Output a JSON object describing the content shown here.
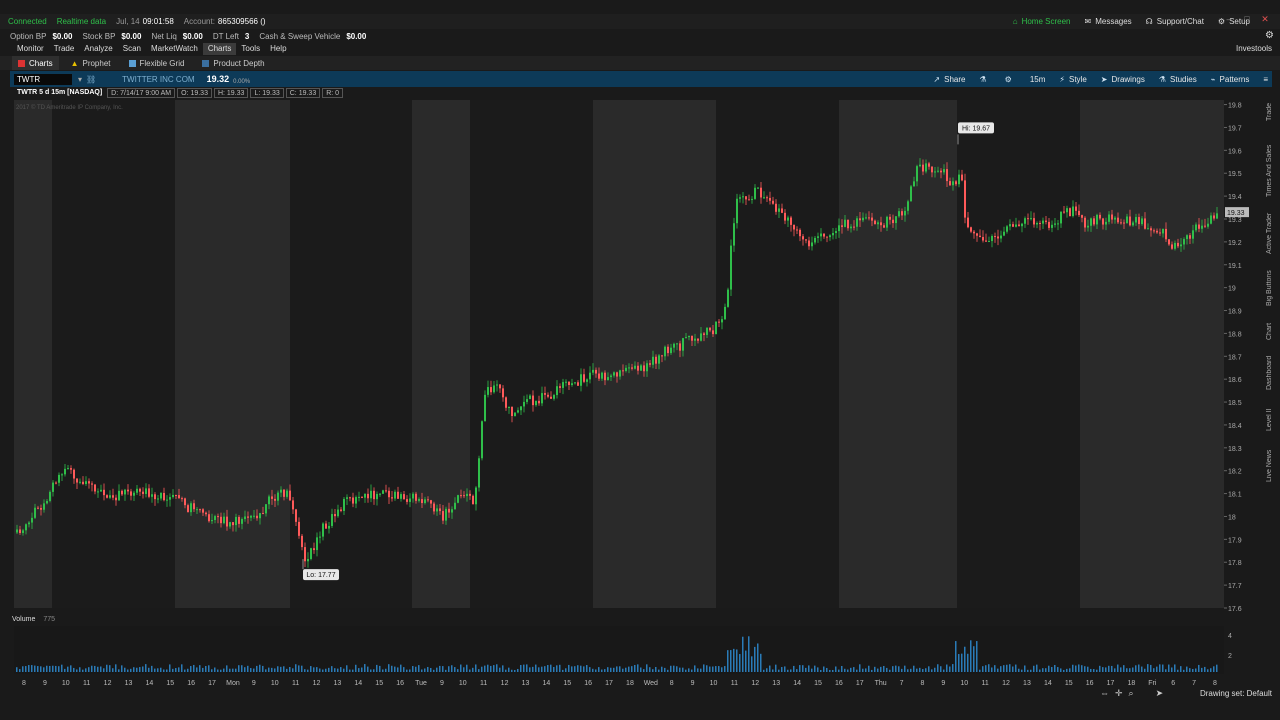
{
  "status": {
    "connected": "Connected",
    "realtime": "Realtime data",
    "date": "Jul, 14",
    "time": "09:01:58",
    "account_label": "Account:",
    "account_value": "865309566 ()",
    "home_screen": "Home Screen",
    "messages": "Messages",
    "support": "Support/Chat",
    "setup": "Setup"
  },
  "balances": [
    {
      "label": "Option BP",
      "value": "$0.00"
    },
    {
      "label": "Stock BP",
      "value": "$0.00"
    },
    {
      "label": "Net Liq",
      "value": "$0.00"
    },
    {
      "label": "DT Left",
      "value": "3"
    },
    {
      "label": "Cash & Sweep Vehicle",
      "value": "$0.00"
    }
  ],
  "main_menu": [
    "Monitor",
    "Trade",
    "Analyze",
    "Scan",
    "MarketWatch",
    "Charts",
    "Tools",
    "Help"
  ],
  "main_menu_active": "Charts",
  "investools": "Investools",
  "sub_tabs": [
    "Charts",
    "Prophet",
    "Flexible Grid",
    "Product Depth"
  ],
  "toolbar": {
    "symbol": "TWTR",
    "company": "TWITTER INC COM",
    "last": "19.32",
    "change": "0.00%",
    "share": "Share",
    "timeframe": "15m",
    "style": "Style",
    "drawings": "Drawings",
    "studies": "Studies",
    "patterns": "Patterns"
  },
  "chart_info": {
    "title": "TWTR 5 d 15m [NASDAQ]",
    "date": "D: 7/14/17 9:00 AM",
    "open": "O: 19.33",
    "high": "H: 19.33",
    "low": "L: 19.33",
    "close": "C: 19.33",
    "range": "R: 0"
  },
  "copyright": "2017 © TD Ameritrade IP Company, Inc.",
  "volume": {
    "label": "Volume",
    "value": "775"
  },
  "right_tabs": [
    "Trade",
    "Times And Sales",
    "Active Trader",
    "Big Buttons",
    "Chart",
    "Dashboard",
    "Level II",
    "Live News"
  ],
  "drawing_set": "Drawing set: Default",
  "colors": {
    "up": "#2fbf4a",
    "down": "#ff5a5a",
    "volume": "#2a7bb8",
    "toolbar": "#0d3a58"
  },
  "chart_data": {
    "type": "candlestick",
    "title": "TWTR 5 d 15m [NASDAQ]",
    "y_ticks": [
      "19.8",
      "19.7",
      "19.6",
      "19.5",
      "19.4",
      "19.3",
      "19.2",
      "19.1",
      "19",
      "18.9",
      "18.8",
      "18.7",
      "18.6",
      "18.5",
      "18.4",
      "18.3",
      "18.2",
      "18.1",
      "18",
      "17.9",
      "17.8",
      "17.7",
      "17.6"
    ],
    "ylim": [
      17.6,
      19.82
    ],
    "x_ticks": [
      "8",
      "9",
      "10",
      "11",
      "12",
      "13",
      "14",
      "15",
      "16",
      "17",
      "Mon",
      "9",
      "10",
      "11",
      "12",
      "13",
      "14",
      "15",
      "16",
      "Tue",
      "9",
      "10",
      "11",
      "12",
      "13",
      "14",
      "15",
      "16",
      "17",
      "18",
      "Wed",
      "8",
      "9",
      "10",
      "11",
      "12",
      "13",
      "14",
      "15",
      "16",
      "17",
      "Thu",
      "7",
      "8",
      "9",
      "10",
      "11",
      "12",
      "13",
      "14",
      "15",
      "16",
      "17",
      "18",
      "Fri",
      "6",
      "7",
      "8"
    ],
    "annotations": [
      {
        "label": "Hi: 19.67",
        "value": 19.67
      },
      {
        "label": "Lo: 17.77",
        "value": 17.77
      }
    ],
    "current_price_label": "19.33",
    "close_path": [
      [
        0,
        17.93
      ],
      [
        0.02,
        18.05
      ],
      [
        0.04,
        18.22
      ],
      [
        0.06,
        18.12
      ],
      [
        0.08,
        18.09
      ],
      [
        0.1,
        18.1
      ],
      [
        0.12,
        18.1
      ],
      [
        0.14,
        18.05
      ],
      [
        0.155,
        18.0
      ],
      [
        0.175,
        17.98
      ],
      [
        0.2,
        17.99
      ],
      [
        0.21,
        18.08
      ],
      [
        0.225,
        18.1
      ],
      [
        0.23,
        18.03
      ],
      [
        0.24,
        17.8
      ],
      [
        0.255,
        17.95
      ],
      [
        0.27,
        18.05
      ],
      [
        0.29,
        18.1
      ],
      [
        0.31,
        18.1
      ],
      [
        0.33,
        18.08
      ],
      [
        0.345,
        18.05
      ],
      [
        0.355,
        18.0
      ],
      [
        0.37,
        18.1
      ],
      [
        0.38,
        18.05
      ],
      [
        0.385,
        18.3
      ],
      [
        0.39,
        18.55
      ],
      [
        0.4,
        18.58
      ],
      [
        0.41,
        18.45
      ],
      [
        0.42,
        18.5
      ],
      [
        0.44,
        18.52
      ],
      [
        0.46,
        18.58
      ],
      [
        0.48,
        18.62
      ],
      [
        0.5,
        18.62
      ],
      [
        0.52,
        18.65
      ],
      [
        0.54,
        18.72
      ],
      [
        0.56,
        18.77
      ],
      [
        0.58,
        18.82
      ],
      [
        0.59,
        18.9
      ],
      [
        0.595,
        19.25
      ],
      [
        0.6,
        19.4
      ],
      [
        0.62,
        19.42
      ],
      [
        0.64,
        19.3
      ],
      [
        0.66,
        19.2
      ],
      [
        0.68,
        19.25
      ],
      [
        0.7,
        19.3
      ],
      [
        0.72,
        19.27
      ],
      [
        0.74,
        19.35
      ],
      [
        0.75,
        19.53
      ],
      [
        0.77,
        19.5
      ],
      [
        0.78,
        19.45
      ],
      [
        0.785,
        19.53
      ],
      [
        0.79,
        19.25
      ],
      [
        0.805,
        19.18
      ],
      [
        0.82,
        19.25
      ],
      [
        0.84,
        19.3
      ],
      [
        0.86,
        19.28
      ],
      [
        0.88,
        19.35
      ],
      [
        0.885,
        19.28
      ],
      [
        0.9,
        19.3
      ],
      [
        0.92,
        19.3
      ],
      [
        0.94,
        19.28
      ],
      [
        0.955,
        19.25
      ],
      [
        0.96,
        19.17
      ],
      [
        0.975,
        19.22
      ],
      [
        0.99,
        19.3
      ],
      [
        1.0,
        19.33
      ]
    ]
  }
}
